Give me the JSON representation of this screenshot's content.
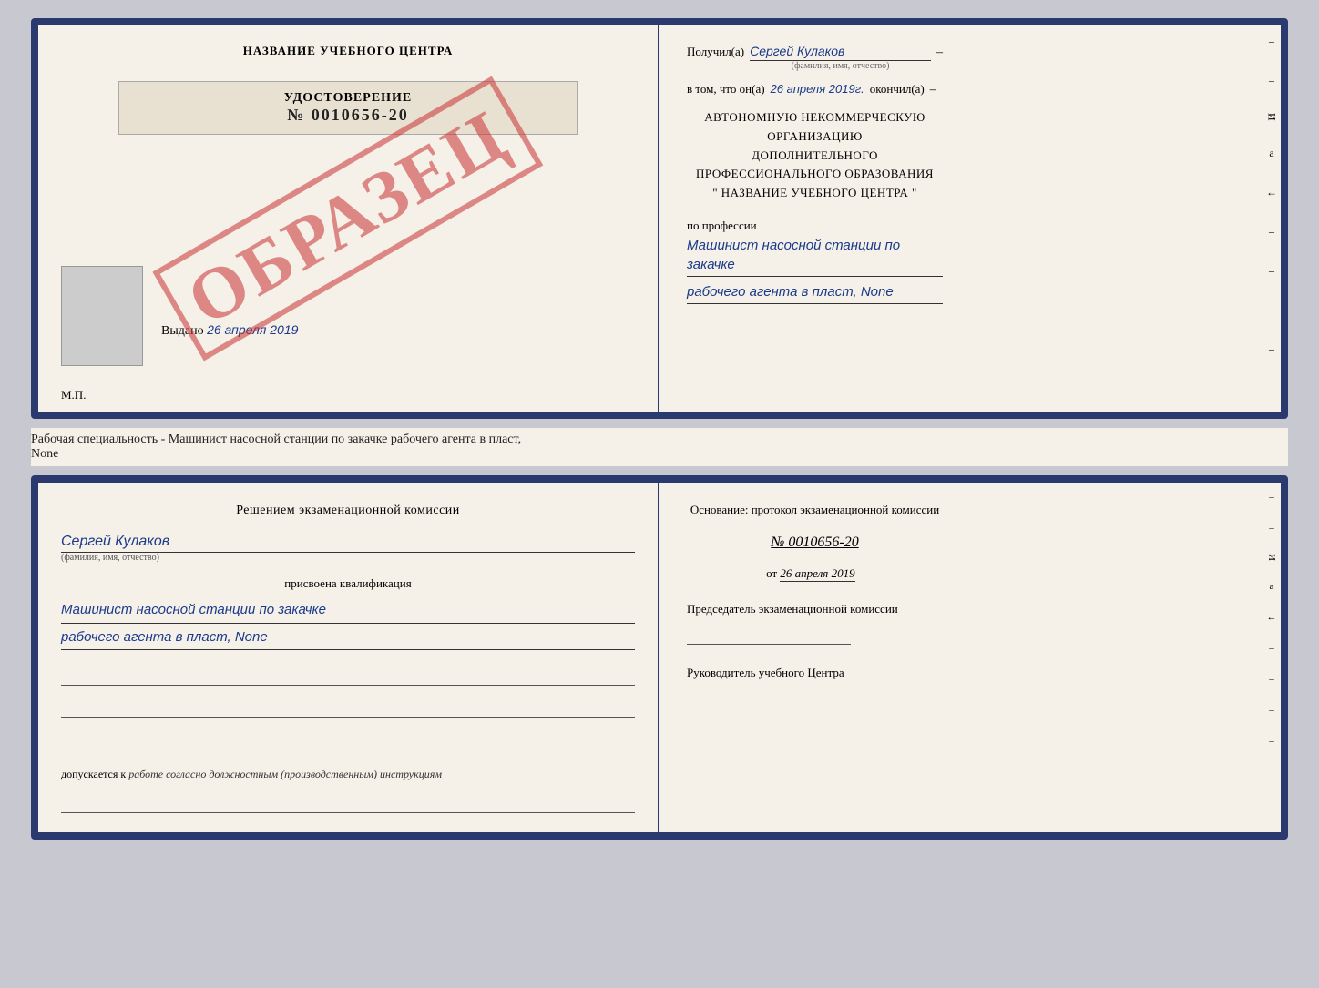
{
  "topDoc": {
    "left": {
      "centerTitle": "НАЗВАНИЕ УЧЕБНОГО ЦЕНТРА",
      "watermark": "ОБРАЗЕЦ",
      "certTitle": "УДОСТОВЕРЕНИЕ",
      "certNumber": "№ 0010656-20",
      "issuedLabel": "Выдано",
      "issuedDate": "26 апреля 2019",
      "mpLabel": "М.П."
    },
    "right": {
      "receivedLabel": "Получил(а)",
      "receivedName": "Сергей Кулаков",
      "receivedSublabel": "(фамилия, имя, отчество)",
      "confirmLabel": "в том, что он(а)",
      "confirmDate": "26 апреля 2019г.",
      "finishedLabel": "окончил(а)",
      "orgLine1": "АВТОНОМНУЮ НЕКОММЕРЧЕСКУЮ ОРГАНИЗАЦИЮ",
      "orgLine2": "ДОПОЛНИТЕЛЬНОГО ПРОФЕССИОНАЛЬНОГО ОБРАЗОВАНИЯ",
      "orgLine3": "\"  НАЗВАНИЕ УЧЕБНОГО ЦЕНТРА  \"",
      "professionLabel": "по профессии",
      "professionLine1": "Машинист насосной станции по закачке",
      "professionLine2": "рабочего агента в пласт, None"
    }
  },
  "separatorText": "Рабочая специальность - Машинист насосной станции по закачке рабочего агента в пласт,",
  "separatorText2": "None",
  "bottomDoc": {
    "left": {
      "commissionTitle": "Решением экзаменационной комиссии",
      "personName": "Сергей Кулаков",
      "personSublabel": "(фамилия, имя, отчество)",
      "assignedLabel": "присвоена квалификация",
      "qualLine1": "Машинист насосной станции по закачке",
      "qualLine2": "рабочего агента в пласт, None",
      "allowedLabel": "допускается к",
      "allowedValue": "работе согласно должностным (производственным) инструкциям"
    },
    "right": {
      "basisLabel": "Основание: протокол экзаменационной комиссии",
      "protocolNumber": "№ 0010656-20",
      "protocolDateLabel": "от",
      "protocolDate": "26 апреля 2019",
      "chairmanLabel": "Председатель экзаменационной комиссии",
      "directorLabel": "Руководитель учебного Центра"
    }
  },
  "edgeMarks": {
    "marks": [
      "И",
      "а",
      "←",
      "–",
      "–",
      "–",
      "–"
    ]
  }
}
